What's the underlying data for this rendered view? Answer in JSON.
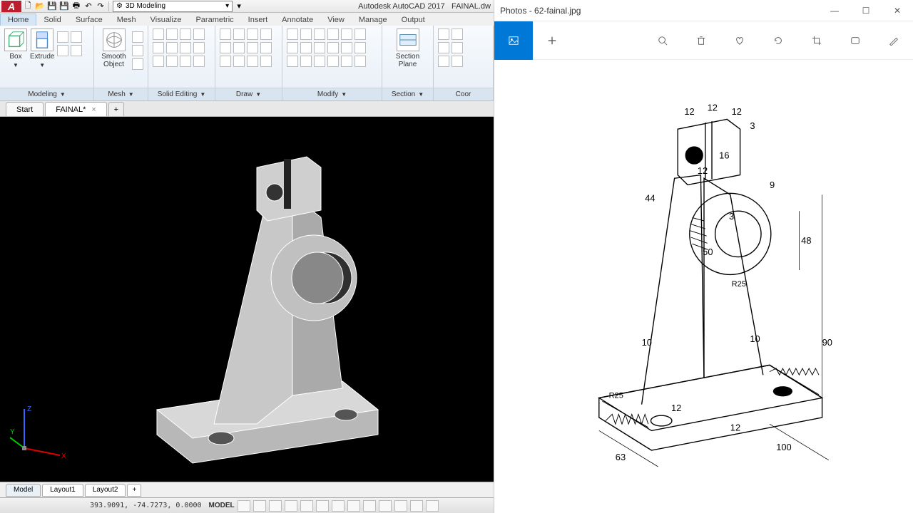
{
  "autocad": {
    "app_title": "Autodesk AutoCAD 2017",
    "doc_title": "FAINAL.dw",
    "workspace": "3D Modeling",
    "ribbon_tabs": [
      "Home",
      "Solid",
      "Surface",
      "Mesh",
      "Visualize",
      "Parametric",
      "Insert",
      "Annotate",
      "View",
      "Manage",
      "Output"
    ],
    "active_ribbon_tab": "Home",
    "panels": {
      "modeling": {
        "title": "Modeling",
        "btn1": "Box",
        "btn2": "Extrude"
      },
      "mesh": {
        "title": "Mesh",
        "btn": "Smooth Object"
      },
      "solid_editing": "Solid Editing",
      "draw": "Draw",
      "modify": "Modify",
      "section": {
        "title": "Section",
        "btn": "Section Plane"
      },
      "coord": "Coor"
    },
    "file_tabs": [
      {
        "label": "Start",
        "closable": false
      },
      {
        "label": "FAINAL*",
        "closable": true
      }
    ],
    "layout_tabs": [
      "Model",
      "Layout1",
      "Layout2"
    ],
    "active_layout": "Model",
    "status": {
      "coords": "393.9091, -74.7273, 0.0000",
      "space": "MODEL"
    },
    "ucs_axes": {
      "x": "X",
      "y": "Y",
      "z": "Z"
    }
  },
  "photos": {
    "title": "Photos - 62-fainal.jpg",
    "toolbar_icons": [
      "image-icon",
      "add-icon",
      "zoom-icon",
      "delete-icon",
      "heart-icon",
      "rotate-icon",
      "crop-icon",
      "slideshow-icon",
      "draw-icon"
    ],
    "drawing_dimensions": {
      "top": [
        "12",
        "12",
        "12",
        "3"
      ],
      "upper": [
        "16",
        "12",
        "9",
        "44",
        "48",
        "50",
        "3"
      ],
      "mid": [
        "R25",
        "10",
        "10",
        "90"
      ],
      "base": [
        "63",
        "100",
        "12",
        "12"
      ]
    }
  }
}
